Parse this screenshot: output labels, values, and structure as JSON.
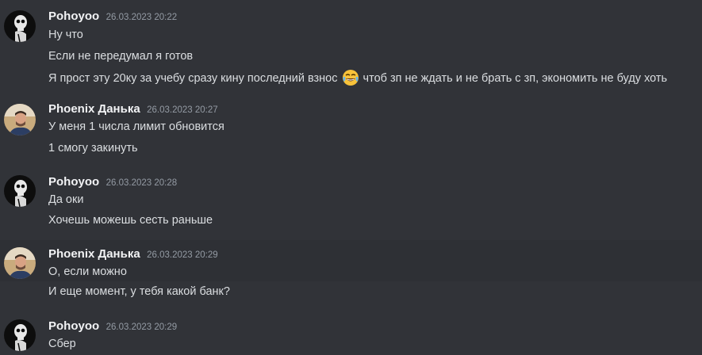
{
  "messages": [
    {
      "author": "Pohoyoo",
      "timestamp": "26.03.2023 20:22",
      "avatar": "pohoyoo-avatar",
      "lines": [
        "Ну что",
        "Если не передумал я готов"
      ],
      "emoji_line": {
        "before": "Я прост эту 20ку за учебу сразу кину последний взнос",
        "emoji": "joy-emoji",
        "after": "чтоб зп не ждать и не брать с зп, экономить не буду хоть"
      }
    },
    {
      "author": "Phoenix Данька",
      "timestamp": "26.03.2023 20:27",
      "avatar": "phoenix-avatar",
      "lines": [
        "У меня 1 числа лимит обновится",
        "1 смогу закинуть"
      ]
    },
    {
      "author": "Pohoyoo",
      "timestamp": "26.03.2023 20:28",
      "avatar": "pohoyoo-avatar",
      "lines": [
        "Да оки",
        "Хочешь можешь сесть раньше"
      ]
    },
    {
      "author": "Phoenix Данька",
      "timestamp": "26.03.2023 20:29",
      "avatar": "phoenix-avatar",
      "lines": [
        "О, если можно",
        "И еще момент, у тебя какой банк?"
      ]
    },
    {
      "author": "Pohoyoo",
      "timestamp": "26.03.2023 20:29",
      "avatar": "pohoyoo-avatar",
      "lines": [
        "Сбер"
      ]
    }
  ],
  "colors": {
    "background": "#313338",
    "hover_background": "#2e3035",
    "username": "#f2f3f5",
    "timestamp": "#949ba4",
    "text": "#dbdee1"
  }
}
